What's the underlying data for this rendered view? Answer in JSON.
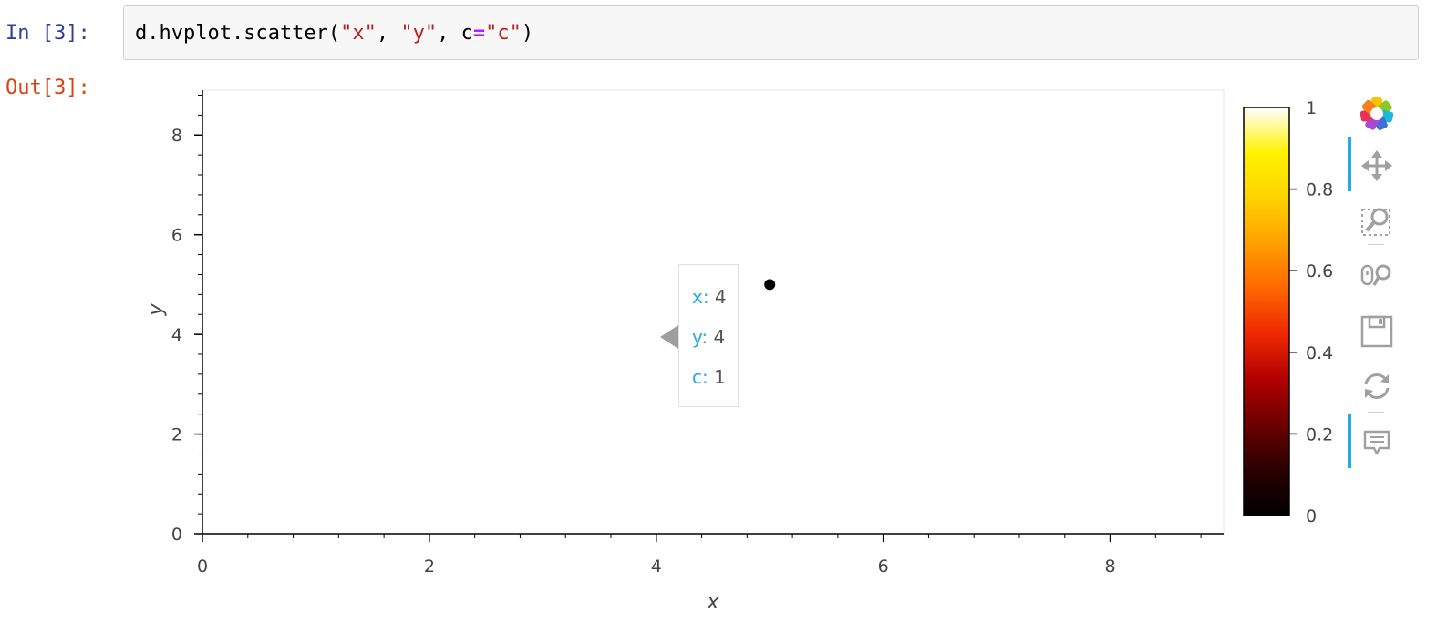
{
  "notebook": {
    "in_prompt": "In [3]:",
    "out_prompt": "Out[3]:",
    "code": {
      "prefix": "d.hvplot.scatter(",
      "arg1": "\"x\"",
      "sep1": ", ",
      "arg2": "\"y\"",
      "sep2": ", c",
      "eq": "=",
      "arg3": "\"c\"",
      "suffix": ")"
    }
  },
  "chart_data": {
    "type": "scatter",
    "xlabel": "x",
    "ylabel": "y",
    "xlim": [
      0,
      9
    ],
    "ylim": [
      0,
      8.9
    ],
    "x_ticks": [
      0,
      2,
      4,
      6,
      8
    ],
    "y_ticks": [
      0,
      2,
      4,
      6,
      8
    ],
    "points": [
      {
        "x": 5,
        "y": 5,
        "c": 1
      }
    ],
    "point_color": "#000000",
    "colorbar": {
      "colormap": "fire",
      "range": [
        0,
        1
      ],
      "ticks": [
        "0",
        "0.2",
        "0.4",
        "0.6",
        "0.8",
        "1"
      ],
      "tick_values": [
        0,
        0.2,
        0.4,
        0.6,
        0.8,
        1
      ],
      "colors": [
        "#000000",
        "#2a0000",
        "#6b0000",
        "#b10000",
        "#ef2800",
        "#ff6600",
        "#ffa000",
        "#ffd200",
        "#fff200",
        "#ffffff"
      ]
    }
  },
  "tooltip": {
    "rows": [
      {
        "key": "x:",
        "value": " 4"
      },
      {
        "key": "y:",
        "value": " 4"
      },
      {
        "key": "c:",
        "value": " 1"
      }
    ]
  },
  "toolbar": {
    "tools": [
      {
        "name": "bokeh-logo",
        "active": false
      },
      {
        "name": "pan",
        "active": true
      },
      {
        "name": "box-zoom",
        "active": false
      },
      {
        "name": "wheel-zoom",
        "active": false
      },
      {
        "name": "save",
        "active": false
      },
      {
        "name": "reset",
        "active": false
      },
      {
        "name": "hover",
        "active": true
      }
    ],
    "colors": {
      "active": "#26aae1",
      "icon": "#a0a0a0"
    }
  }
}
